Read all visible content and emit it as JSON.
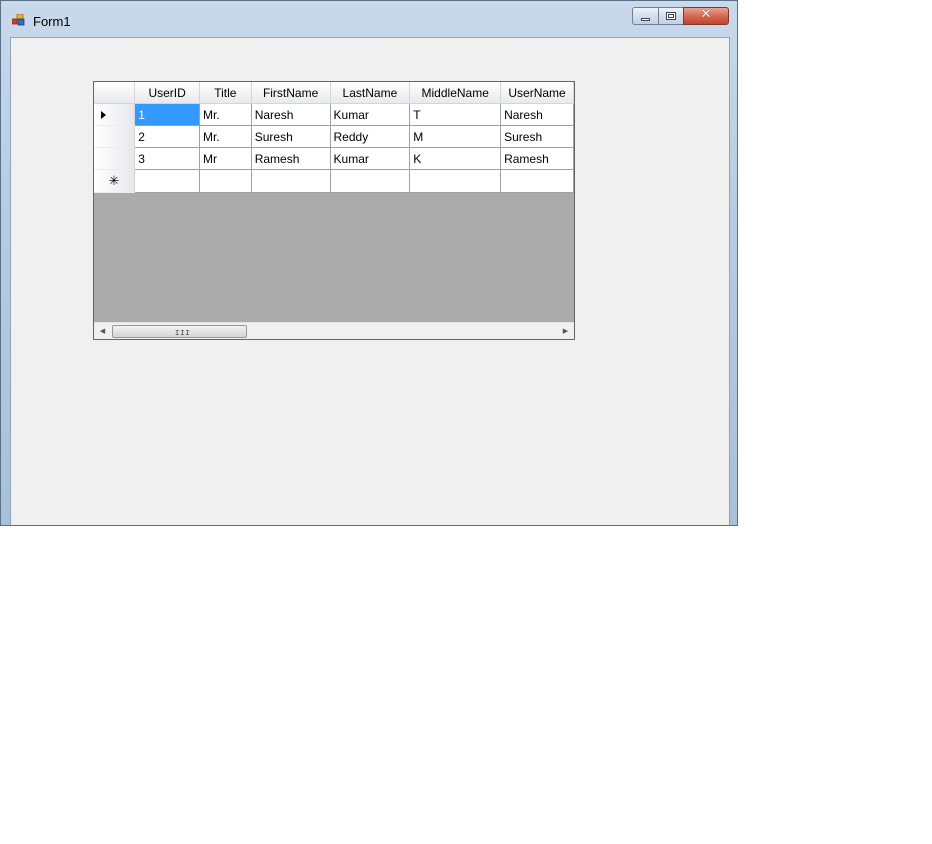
{
  "window": {
    "title": "Form1"
  },
  "grid": {
    "columns": [
      "UserID",
      "Title",
      "FirstName",
      "LastName",
      "MiddleName",
      "UserName"
    ],
    "rows": [
      [
        "1",
        "Mr.",
        "Naresh",
        "Kumar",
        "T",
        "Naresh"
      ],
      [
        "2",
        "Mr.",
        "Suresh",
        "Reddy",
        "M",
        "Suresh"
      ],
      [
        "3",
        "Mr",
        "Ramesh",
        "Kumar",
        "K",
        "Ramesh"
      ]
    ],
    "current_row_indicator": "current-row-arrow-icon",
    "new_row_glyph": "✳"
  },
  "scrollbar": {
    "grip": "III"
  },
  "colors": {
    "selection": "#3399ff",
    "grid_background": "#ababab",
    "client_background": "#f0f0f0"
  }
}
